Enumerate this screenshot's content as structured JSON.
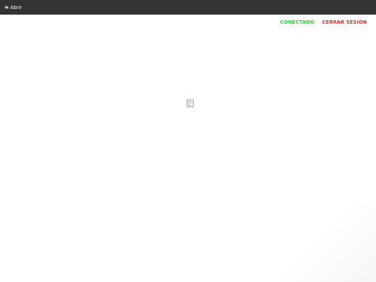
{
  "topbar": {
    "menu_icon": "≡",
    "menu_label": "Abrir"
  },
  "status": {
    "connected_label": "CONECTADO",
    "connected_color": "#22dd22",
    "logout_label": "CERRAR SESIÓN",
    "logout_color": "#ff2222"
  },
  "content": {
    "image_icon": "broken-image-icon"
  },
  "colors": {
    "topbar_bg": "#333333",
    "page_bg": "#ffffff"
  }
}
